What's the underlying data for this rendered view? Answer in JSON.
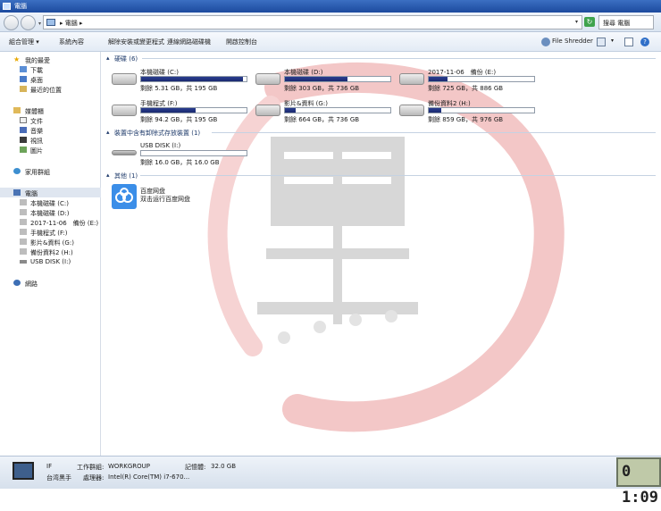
{
  "window": {
    "title": "電腦"
  },
  "address": {
    "path": "▸ 電腦 ▸",
    "search_placeholder": "搜尋 電腦"
  },
  "toolbar": {
    "organize": "組合管理 ▾",
    "properties": "系統內容",
    "uninstall": "解除安裝或變更程式",
    "map_drive": "連線網路磁碟機",
    "control_panel": "開啟控制台",
    "file_shredder": "File Shredder"
  },
  "sidebar": {
    "favorites_header": "我的最愛",
    "favorites": [
      "下載",
      "桌面",
      "最近的位置"
    ],
    "libraries_header": "媒體櫃",
    "libraries": [
      "文件",
      "音樂",
      "視訊",
      "圖片"
    ],
    "homegroup": "家用群組",
    "computer_header": "電腦",
    "computer": [
      "本機磁碟 (C:)",
      "本機磁碟 (D:)",
      "2017-11-06　備份 (E:)",
      "手機程式 (F:)",
      "影片&資料 (G:)",
      "備份資料2 (H:)",
      "USB DISK (I:)"
    ],
    "network": "網路"
  },
  "sections": {
    "hdd": "硬碟 (6)",
    "removable": "裝置中含有卸除式存放裝置 (1)",
    "other": "其他 (1)"
  },
  "drives": [
    {
      "name": "本機磁碟 (C:)",
      "size": "剩餘 5.31 GB，共 195 GB",
      "used_fraction": 0.97
    },
    {
      "name": "本機磁碟 (D:)",
      "size": "剩餘 303 GB，共 736 GB",
      "used_fraction": 0.59
    },
    {
      "name": "2017-11-06　備份 (E:)",
      "size": "剩餘 725 GB，共 886 GB",
      "used_fraction": 0.18
    },
    {
      "name": "手機程式 (F:)",
      "size": "剩餘 94.2 GB，共 195 GB",
      "used_fraction": 0.52
    },
    {
      "name": "影片&資料 (G:)",
      "size": "剩餘 664 GB，共 736 GB",
      "used_fraction": 0.1
    },
    {
      "name": "備份資料2 (H:)",
      "size": "剩餘 859 GB，共 976 GB",
      "used_fraction": 0.12
    }
  ],
  "usb": {
    "name": "USB DISK (I:)",
    "size": "剩餘 16.0 GB，共 16.0 GB",
    "used_fraction": 0.0
  },
  "other_item": {
    "name": "百度网盘",
    "desc": "双击运行百度网盘"
  },
  "status": {
    "name": "IF",
    "workgroup_label": "工作群組:",
    "workgroup": "WORKGROUP",
    "memory_label": "記憶體:",
    "memory": "32.0 GB",
    "org": "台湾黑手",
    "cpu_label": "處理器:",
    "cpu": "Intel(R) Core(TM) i7-670..."
  },
  "clock": "0 1:09",
  "colors": {
    "accent": "#1c4a9e",
    "bar_fill": "#1a2a70",
    "watermark": "#e04040"
  }
}
